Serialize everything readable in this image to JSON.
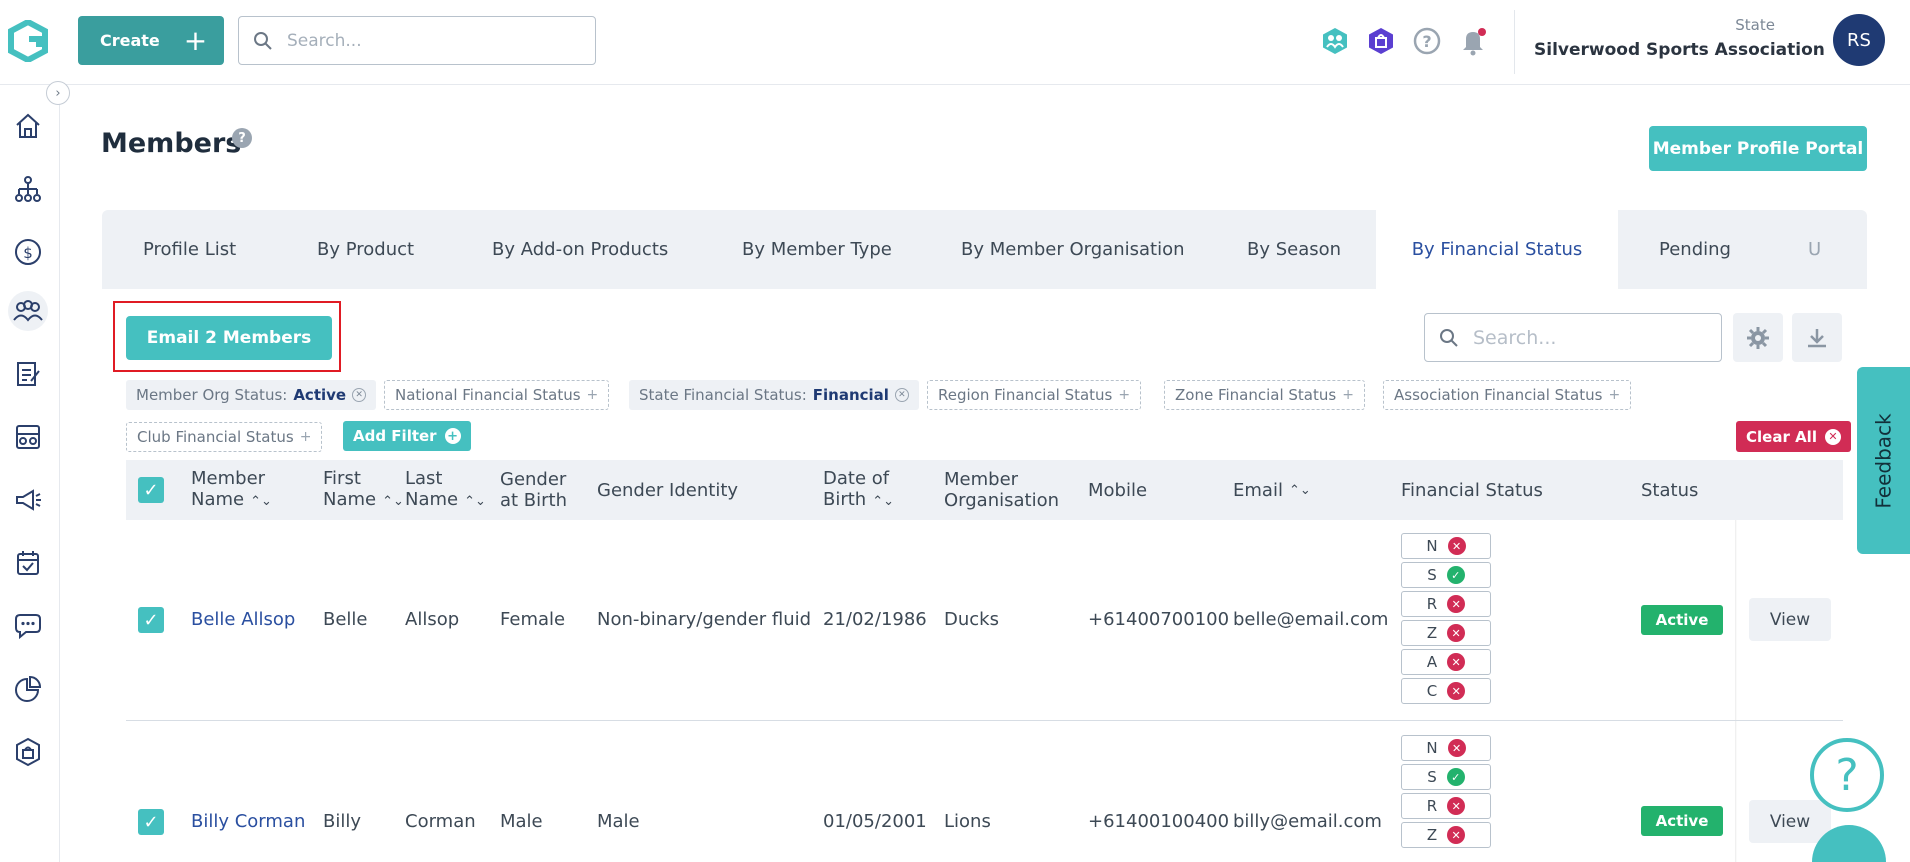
{
  "topbar": {
    "create_label": "Create",
    "search_placeholder": "Search...",
    "org_state": "State",
    "org_name": "Silverwood Sports Association",
    "avatar_initials": "RS"
  },
  "page": {
    "title": "Members",
    "portal_button": "Member Profile Portal"
  },
  "tabs": [
    "Profile List",
    "By Product",
    "By Add-on Products",
    "By Member Type",
    "By Member Organisation",
    "By Season",
    "By Financial Status",
    "Pending",
    "U"
  ],
  "active_tab": "By Financial Status",
  "panel": {
    "email_button": "Email 2 Members",
    "search_placeholder": "Search..."
  },
  "filters": {
    "member_org_label": "Member Org Status:",
    "member_org_value": "Active",
    "national": "National Financial Status",
    "state_label": "State Financial Status:",
    "state_value": "Financial",
    "region": "Region Financial Status",
    "zone": "Zone Financial Status",
    "association": "Association Financial Status",
    "club": "Club Financial Status",
    "add_filter": "Add Filter",
    "clear_all": "Clear All"
  },
  "table": {
    "headers": {
      "member_name_1": "Member",
      "member_name_2": "Name",
      "first_name_1": "First",
      "first_name_2": "Name",
      "last_name_1": "Last",
      "last_name_2": "Name",
      "gender_1": "Gender",
      "gender_2": "at Birth",
      "gender_identity": "Gender Identity",
      "dob_1": "Date of",
      "dob_2": "Birth",
      "org_1": "Member",
      "org_2": "Organisation",
      "mobile": "Mobile",
      "email": "Email",
      "financial_status": "Financial Status",
      "status": "Status"
    },
    "rows": [
      {
        "member_name": "Belle Allsop",
        "first_name": "Belle",
        "last_name": "Allsop",
        "gender": "Female",
        "gender_identity": "Non-binary/gender fluid",
        "dob": "21/02/1986",
        "organisation": "Ducks",
        "mobile": "+61400700100",
        "email": "belle@email.com",
        "status": "Active",
        "view": "View"
      },
      {
        "member_name": "Billy Corman",
        "first_name": "Billy",
        "last_name": "Corman",
        "gender": "Male",
        "gender_identity": "Male",
        "dob": "01/05/2001",
        "organisation": "Lions",
        "mobile": "+61400100400",
        "email": "billy@email.com",
        "status": "Active",
        "view": "View"
      }
    ],
    "financial_levels": [
      "N",
      "S",
      "R",
      "Z",
      "A",
      "C"
    ]
  },
  "feedback_label": "Feedback",
  "help_glyph": "?",
  "colors": {
    "primary": "#45c0c0",
    "primary_dark": "#3a9e9e",
    "danger": "#d12c55",
    "success": "#23b26d",
    "active_tab_text": "#2a4fa0",
    "avatar": "#1f3a73",
    "highlight": "#e01b24"
  }
}
